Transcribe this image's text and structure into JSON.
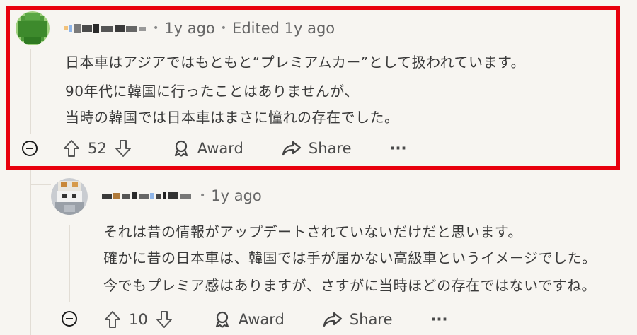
{
  "comment1": {
    "time": "1y ago",
    "edited": "Edited 1y ago",
    "lines": [
      "日本車はアジアではもともと“プレミアムカー”として扱われています。",
      "90年代に韓国に行ったことはありませんが、",
      "当時の韓国では日本車はまさに憧れの存在でした。"
    ],
    "votes": "52",
    "award_label": "Award",
    "share_label": "Share",
    "more_label": "···"
  },
  "comment2": {
    "time": "1y ago",
    "lines": [
      "それは昔の情報がアップデートされていないだけだと思います。",
      "確かに昔の日本車は、韓国では手が届かない高級車というイメージでした。",
      "今でもプレミア感はありますが、さすがに当時ほどの存在ではないですね。"
    ],
    "votes": "10",
    "award_label": "Award",
    "share_label": "Share",
    "more_label": "···"
  },
  "colors": {
    "highlight_border": "#e8000d",
    "avatar1": "#3f8f2f"
  }
}
